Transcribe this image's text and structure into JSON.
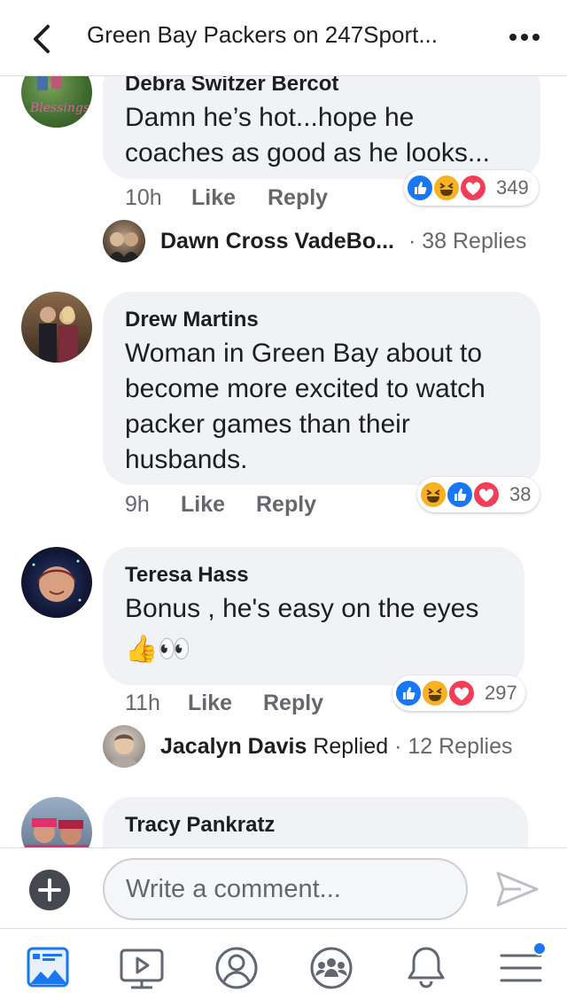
{
  "header": {
    "title": "Green Bay Packers on 247Sport..."
  },
  "comments": [
    {
      "name": "Debra Switzer Bercot",
      "text_lines": [
        "Damn he’s hot...hope he",
        "coaches as good as he looks..."
      ],
      "time": "10h",
      "like": "Like",
      "reply": "Reply",
      "reactions": [
        "like-icon",
        "haha-icon",
        "love-icon"
      ],
      "reaction_count": "349",
      "replies": {
        "name": "Dawn Cross VadeBo...",
        "suffix": "",
        "count": "· 38 Replies"
      }
    },
    {
      "name": "Drew Martins",
      "text_lines": [
        "Woman in Green Bay about to",
        "become more excited to watch",
        "packer games than their",
        "husbands."
      ],
      "time": "9h",
      "like": "Like",
      "reply": "Reply",
      "reactions": [
        "haha-icon",
        "like-icon",
        "love-icon"
      ],
      "reaction_count": "38"
    },
    {
      "name": "Teresa Hass",
      "text_lines": [
        "Bonus , he's easy on the eyes"
      ],
      "emoji": "👍👀",
      "time": "11h",
      "like": "Like",
      "reply": "Reply",
      "reactions": [
        "like-icon",
        "haha-icon",
        "love-icon"
      ],
      "reaction_count": "297",
      "replies": {
        "name": "Jacalyn Davis",
        "suffix": " Replied",
        "count": " · 12 Replies"
      }
    },
    {
      "name": "Tracy Pankratz"
    }
  ],
  "composer": {
    "placeholder": "Write a comment..."
  },
  "tabs": [
    "news-feed-icon",
    "watch-icon",
    "profile-icon",
    "groups-icon",
    "notifications-icon",
    "menu-icon"
  ],
  "colors": {
    "like": "#1877f2",
    "love": "#f33e58",
    "haha": "#f7b125",
    "accent": "#1877f2"
  }
}
